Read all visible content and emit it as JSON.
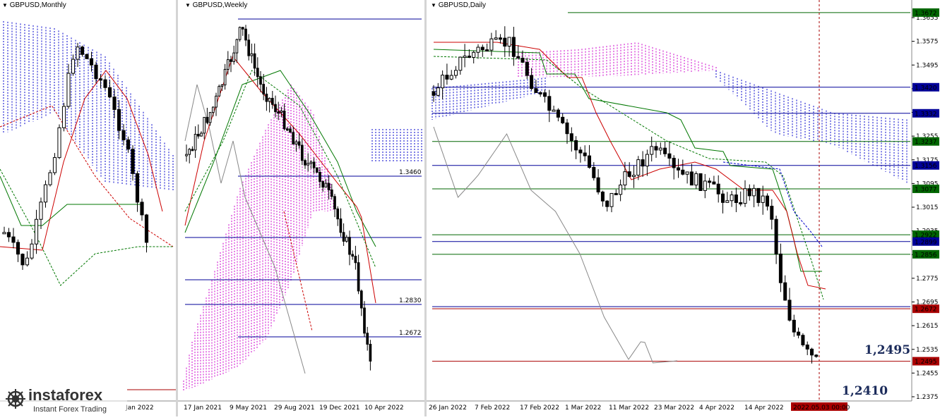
{
  "panels": {
    "monthly": {
      "title": "GBPUSD,Monthly",
      "dates": [
        "Jan 2022"
      ]
    },
    "weekly": {
      "title": "GBPUSD,Weekly",
      "dates": [
        "17 Jan 2021",
        "9 May 2021",
        "29 Aug 2021",
        "19 Dec 2021",
        "10 Apr 2022"
      ],
      "levels": [
        "1.3460",
        "1.2830",
        "1.2672"
      ]
    },
    "daily": {
      "title": "GBPUSD,Daily",
      "dates": [
        "26 Jan 2022",
        "7 Feb 2022",
        "17 Feb 2022",
        "1 Mar 2022",
        "11 Mar 2022",
        "23 Mar 2022",
        "4 Apr 2022",
        "14 Apr 2022"
      ],
      "cursor_date": "2022.05.03 00:00",
      "price_ticks": [
        "1.3655",
        "1.3575",
        "1.3495",
        "1.3415",
        "1.3335",
        "1.3255",
        "1.3175",
        "1.3095",
        "1.3015",
        "1.2935",
        "1.2855",
        "1.2775",
        "1.2695",
        "1.2615",
        "1.2535",
        "1.2455",
        "1.2375"
      ],
      "tags": [
        {
          "label": "1.3672",
          "kind": "green"
        },
        {
          "label": "1.3420",
          "kind": "blue"
        },
        {
          "label": "1.3332",
          "kind": "blue"
        },
        {
          "label": "1.3237",
          "kind": "green"
        },
        {
          "label": "1.3156",
          "kind": "blue"
        },
        {
          "label": "1.3077",
          "kind": "green"
        },
        {
          "label": "1.2922",
          "kind": "green"
        },
        {
          "label": "1.2899",
          "kind": "blue"
        },
        {
          "label": "1.2856",
          "kind": "green"
        },
        {
          "label": "1.2672",
          "kind": "red"
        },
        {
          "label": "1.2495",
          "kind": "red"
        }
      ],
      "annotations": {
        "current": "1,2495",
        "low": "1,2410"
      }
    }
  },
  "logo": {
    "brand": "instaforex",
    "tagline": "Instant Forex Trading"
  },
  "colors": {
    "bull": "#ffffff",
    "bear": "#000000",
    "cloud_pink": "#cc00cc",
    "cloud_blue": "#0000cc",
    "kijun": "#007700",
    "tenkan": "#cc0000",
    "level_blue": "#000099",
    "level_green": "#006600",
    "tag_red": "#aa0000"
  },
  "chart_data": [
    {
      "type": "candlestick",
      "title": "GBPUSD,Monthly",
      "x": [
        "Jan 2022"
      ]
    },
    {
      "type": "candlestick",
      "title": "GBPUSD,Weekly",
      "x": [
        "17 Jan 2021",
        "9 May 2021",
        "29 Aug 2021",
        "19 Dec 2021",
        "10 Apr 2022"
      ],
      "levels": [
        1.346,
        1.283,
        1.2672
      ]
    },
    {
      "type": "candlestick",
      "title": "GBPUSD,Daily",
      "x": [
        "26 Jan 2022",
        "7 Feb 2022",
        "17 Feb 2022",
        "1 Mar 2022",
        "11 Mar 2022",
        "23 Mar 2022",
        "4 Apr 2022",
        "14 Apr 2022"
      ],
      "ylim": [
        1.2375,
        1.3655
      ],
      "levels": [
        1.3672,
        1.342,
        1.3332,
        1.3237,
        1.3156,
        1.3077,
        1.2922,
        1.2899,
        1.2856,
        1.2672,
        1.2495
      ],
      "current_price": 1.2495,
      "low": 1.241
    }
  ]
}
